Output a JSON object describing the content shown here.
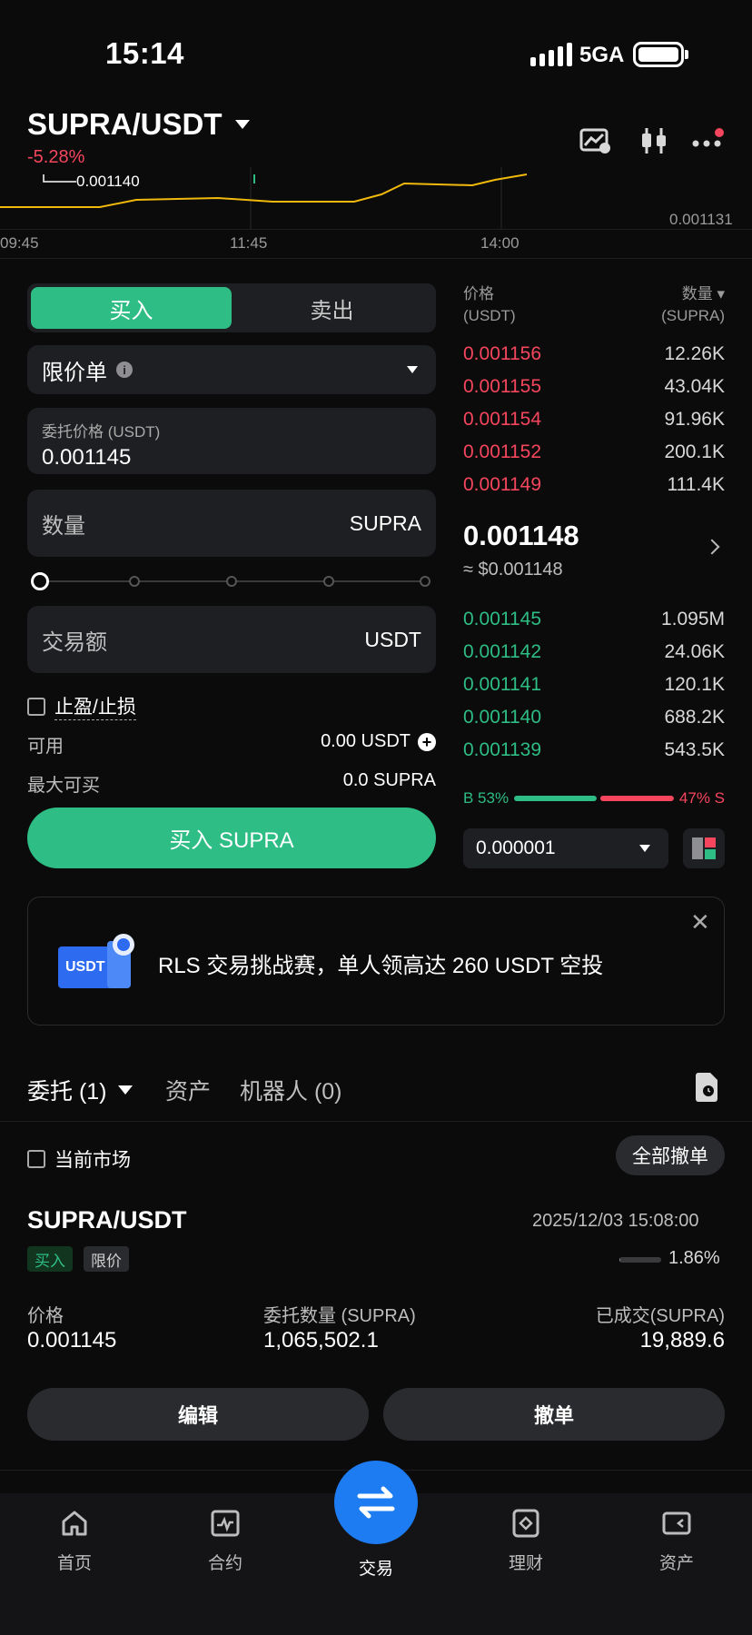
{
  "status_bar": {
    "time": "15:14",
    "network": "5GA"
  },
  "header": {
    "pair": "SUPRA/USDT",
    "change": "-5.28%",
    "icons": [
      "chart-settings-icon",
      "candlestick-icon",
      "more-icon"
    ]
  },
  "mini_chart": {
    "low_label": "0.001140",
    "right_value": "0.001131",
    "x_ticks": [
      "09:45",
      "11:45",
      "14:00"
    ]
  },
  "trade_form": {
    "tabs": [
      "买入",
      "卖出"
    ],
    "active_tab": "买入",
    "order_type": "限价单",
    "price_label": "委托价格 (USDT)",
    "price_value": "0.001145",
    "qty_placeholder": "数量",
    "qty_unit": "SUPRA",
    "amount_placeholder": "交易额",
    "amount_unit": "USDT",
    "tpsl_label": "止盈/止损",
    "available_label": "可用",
    "available_value": "0.00 USDT",
    "max_buy_label": "最大可买",
    "max_buy_value": "0.0 SUPRA",
    "submit_label": "买入 SUPRA",
    "accent": "#2ebd85"
  },
  "orderbook": {
    "price_header": "价格",
    "price_unit": "(USDT)",
    "qty_header": "数量",
    "qty_unit": "(SUPRA)",
    "asks": [
      {
        "price": "0.001156",
        "qty": "12.26K"
      },
      {
        "price": "0.001155",
        "qty": "43.04K"
      },
      {
        "price": "0.001154",
        "qty": "91.96K"
      },
      {
        "price": "0.001152",
        "qty": "200.1K"
      },
      {
        "price": "0.001149",
        "qty": "111.4K"
      }
    ],
    "last_price": "0.001148",
    "last_price_usd": "≈ $0.001148",
    "bids": [
      {
        "price": "0.001145",
        "qty": "1.095M"
      },
      {
        "price": "0.001142",
        "qty": "24.06K"
      },
      {
        "price": "0.001141",
        "qty": "120.1K"
      },
      {
        "price": "0.001140",
        "qty": "688.2K"
      },
      {
        "price": "0.001139",
        "qty": "543.5K"
      }
    ],
    "buy_ratio_label": "B 53%",
    "sell_ratio_label": "47% S",
    "buy_ratio": 0.53,
    "precision": "0.000001",
    "ask_color": "#f6465d",
    "bid_color": "#2ebd85"
  },
  "banner": {
    "badge": "USDT",
    "text": "RLS 交易挑战赛，单人领高达 260 USDT 空投"
  },
  "orders": {
    "tabs": [
      "委托 (1)",
      "资产",
      "机器人 (0)"
    ],
    "current_market_label": "当前市场",
    "cancel_all_label": "全部撤单",
    "order": {
      "pair": "SUPRA/USDT",
      "time": "2025/12/03 15:08:00",
      "side_tag": "买入",
      "type_tag": "限价",
      "fill_percent": "1.86%",
      "fill_ratio": 0.0186,
      "price_label": "价格",
      "price_value": "0.001145",
      "qty_label": "委托数量 (SUPRA)",
      "qty_value": "1,065,502.1",
      "filled_label": "已成交(SUPRA)",
      "filled_value": "19,889.6",
      "edit_label": "编辑",
      "cancel_label": "撤单"
    }
  },
  "bottom_nav": {
    "items": [
      {
        "label": "首页",
        "icon": "home-icon"
      },
      {
        "label": "合约",
        "icon": "futures-icon"
      },
      {
        "label": "交易",
        "icon": "swap-icon"
      },
      {
        "label": "理财",
        "icon": "earn-icon"
      },
      {
        "label": "资产",
        "icon": "wallet-icon"
      }
    ],
    "active": "交易",
    "fab_color": "#1e7cf2"
  }
}
